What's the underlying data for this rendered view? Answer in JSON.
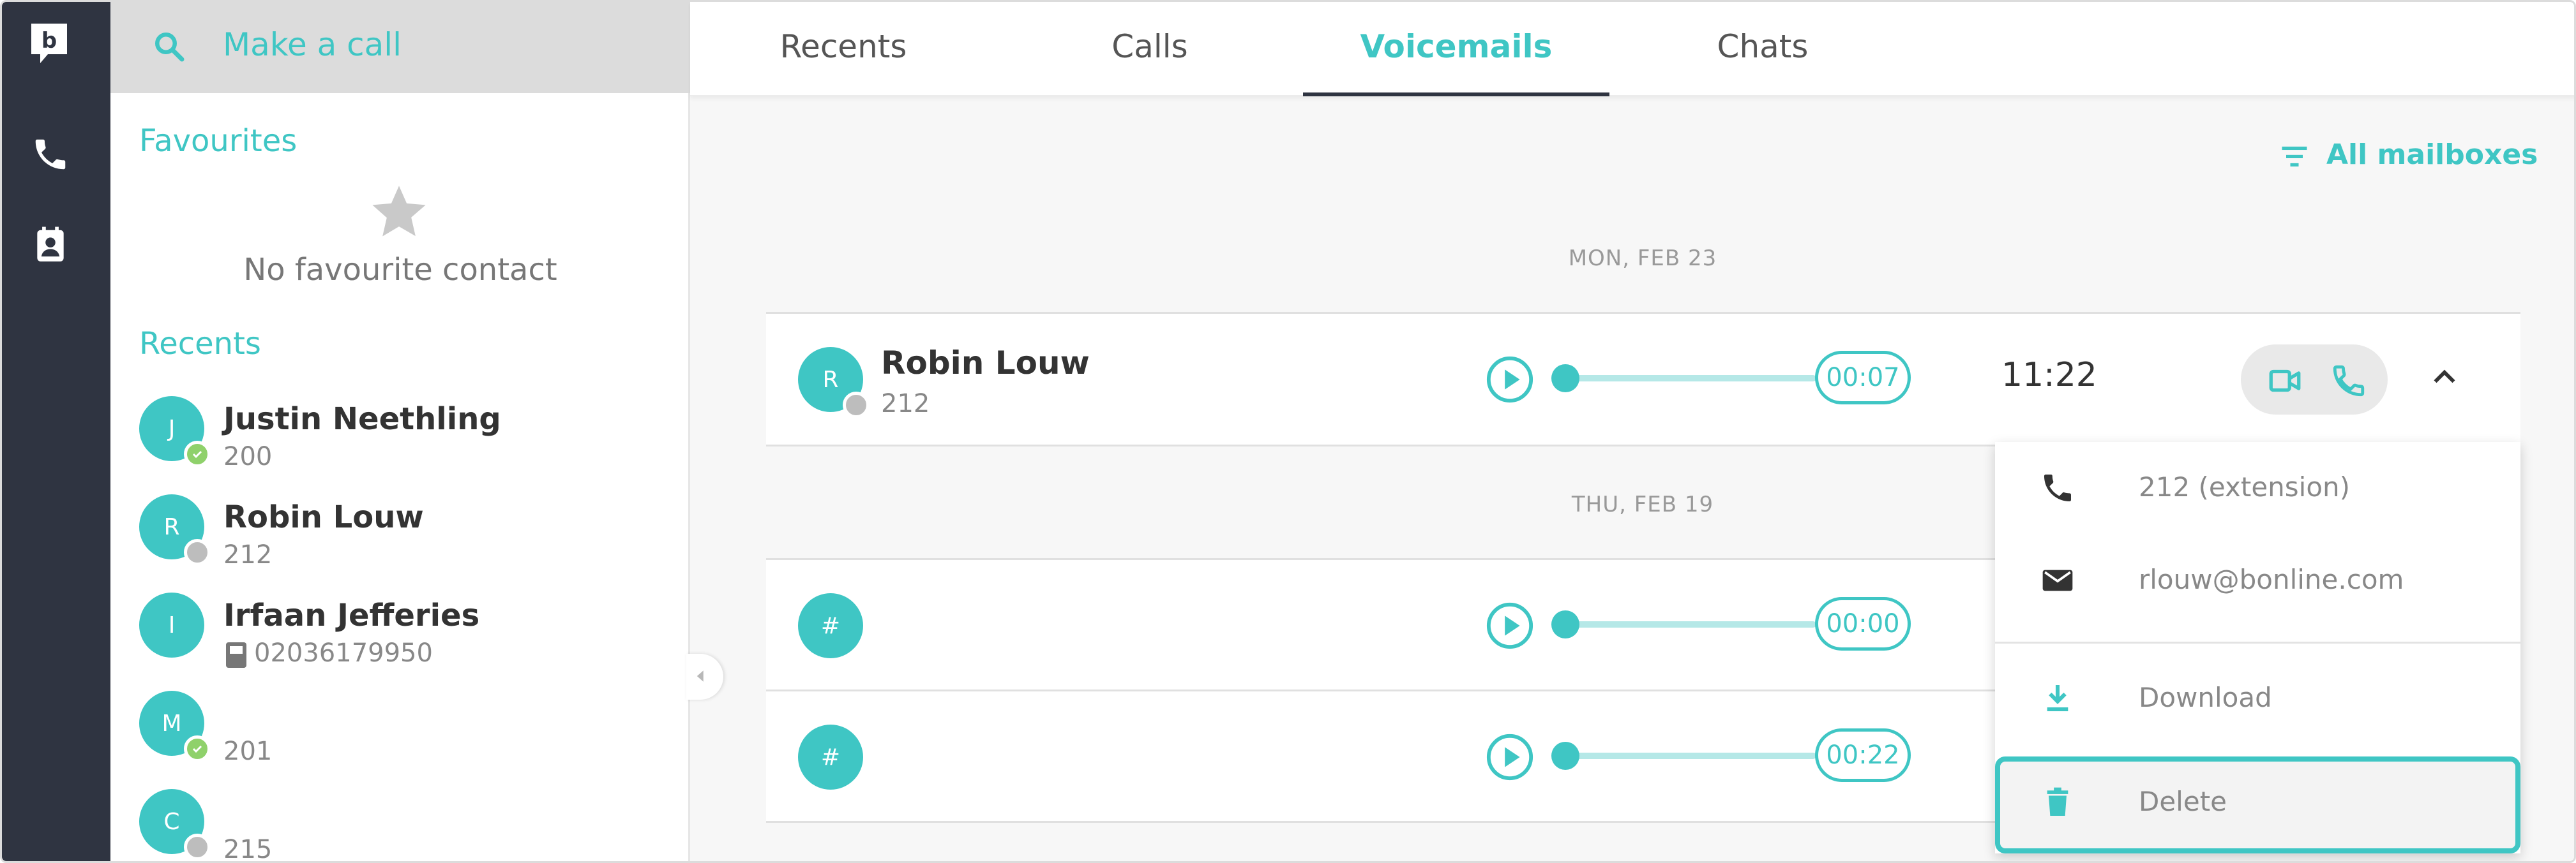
{
  "theme": {
    "accent": "#3fc6c4",
    "rail": "#2f3441"
  },
  "rail": {
    "logo_letter": "b",
    "icons": [
      "phone-icon",
      "contacts-icon"
    ]
  },
  "search": {
    "placeholder": "Make a call",
    "icon": "search-icon"
  },
  "favourites": {
    "title": "Favourites",
    "empty_text": "No favourite contact",
    "icon": "star-icon"
  },
  "recents": {
    "title": "Recents",
    "items": [
      {
        "initial": "J",
        "name": "Justin Neethling",
        "number": "200",
        "status": "available"
      },
      {
        "initial": "R",
        "name": "Robin Louw",
        "number": "212",
        "status": "offline"
      },
      {
        "initial": "I",
        "name": "Irfaan Jefferies",
        "number": "02036179950",
        "status": "phonebook"
      },
      {
        "initial": "M",
        "name": "",
        "number": "201",
        "status": "available"
      },
      {
        "initial": "C",
        "name": "",
        "number": "215",
        "status": "offline"
      }
    ]
  },
  "tabs": [
    {
      "label": "Recents",
      "active": false
    },
    {
      "label": "Calls",
      "active": false
    },
    {
      "label": "Voicemails",
      "active": true
    },
    {
      "label": "Chats",
      "active": false
    }
  ],
  "filter": {
    "label": "All mailboxes",
    "icon": "filter-icon"
  },
  "voicemails": {
    "groups": [
      {
        "date": "MON, FEB 23",
        "items": [
          {
            "initial": "R",
            "name": "Robin Louw",
            "number": "212",
            "duration": "00:07",
            "time": "11:22",
            "expanded": true
          }
        ]
      },
      {
        "date": "THU, FEB 19",
        "items": [
          {
            "initial": "#",
            "name": "",
            "number": "",
            "duration": "00:00",
            "time": ""
          },
          {
            "initial": "#",
            "name": "",
            "number": "",
            "duration": "00:22",
            "time": ""
          }
        ]
      }
    ]
  },
  "menu": {
    "items": [
      {
        "icon": "phone-icon",
        "label": "212 (extension)"
      },
      {
        "icon": "mail-icon",
        "label": "rlouw@bonline.com"
      },
      {
        "icon": "download-icon",
        "label": "Download"
      },
      {
        "icon": "trash-icon",
        "label": "Delete",
        "highlighted": true
      }
    ]
  }
}
